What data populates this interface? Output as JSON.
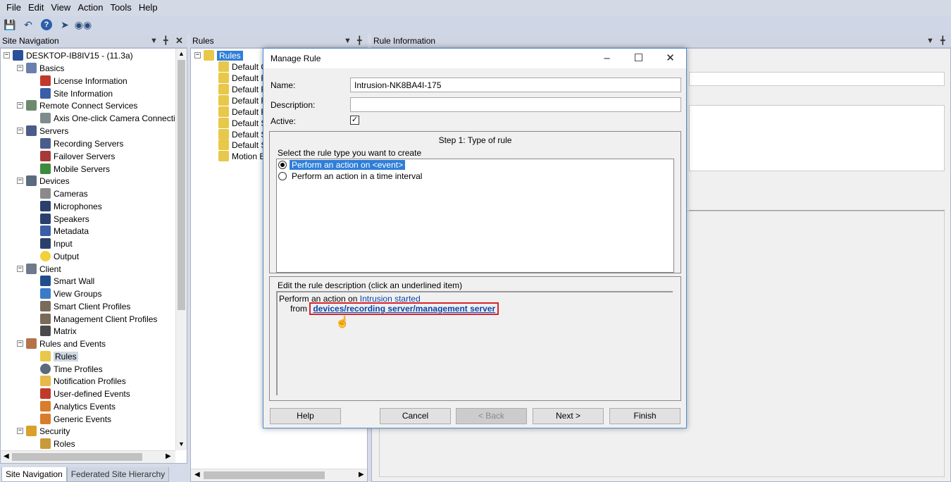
{
  "menu": [
    "File",
    "Edit",
    "View",
    "Action",
    "Tools",
    "Help"
  ],
  "toolbar_icons": [
    "save-icon",
    "undo-icon",
    "help-icon",
    "sync-icon",
    "binoculars-icon"
  ],
  "site_nav": {
    "header": "Site Navigation",
    "root": "DESKTOP-IB8IV15 - (11.3a)",
    "groups": [
      {
        "label": "Basics",
        "items": [
          "License Information",
          "Site Information"
        ]
      },
      {
        "label": "Remote Connect Services",
        "items": [
          "Axis One-click Camera Connectio"
        ]
      },
      {
        "label": "Servers",
        "items": [
          "Recording Servers",
          "Failover Servers",
          "Mobile Servers"
        ]
      },
      {
        "label": "Devices",
        "items": [
          "Cameras",
          "Microphones",
          "Speakers",
          "Metadata",
          "Input",
          "Output"
        ]
      },
      {
        "label": "Client",
        "items": [
          "Smart Wall",
          "View Groups",
          "Smart Client Profiles",
          "Management Client Profiles",
          "Matrix"
        ]
      },
      {
        "label": "Rules and Events",
        "items": [
          "Rules",
          "Time Profiles",
          "Notification Profiles",
          "User-defined Events",
          "Analytics Events",
          "Generic Events"
        ]
      },
      {
        "label": "Security",
        "items": [
          "Roles"
        ]
      }
    ],
    "tabs": [
      "Site Navigation",
      "Federated Site Hierarchy"
    ]
  },
  "rules_pane": {
    "header": "Rules",
    "root": "Rules",
    "items": [
      "Default G",
      "Default F",
      "Default R",
      "Default R",
      "Default R",
      "Default S",
      "Default S",
      "Default S",
      "Motion E"
    ]
  },
  "rule_info": {
    "header": "Rule Information"
  },
  "dialog": {
    "title": "Manage Rule",
    "name_label": "Name:",
    "name_value": "Intrusion-NK8BA4I-175",
    "description_label": "Description:",
    "description_value": "",
    "active_label": "Active:",
    "active_checked": "✓",
    "step_title": "Step 1: Type of rule",
    "select_label": "Select the rule type you want to create",
    "options": [
      "Perform an action on <event>",
      "Perform an action in a time interval"
    ],
    "edit_label": "Edit the rule description (click an underlined item)",
    "desc_line1_prefix": "Perform an action on ",
    "desc_line1_link": "Intrusion started",
    "desc_line2_prefix": "from ",
    "desc_line2_link": "devices/recording server/management server",
    "buttons": {
      "help": "Help",
      "cancel": "Cancel",
      "back": "< Back",
      "next": "Next >",
      "finish": "Finish"
    }
  }
}
